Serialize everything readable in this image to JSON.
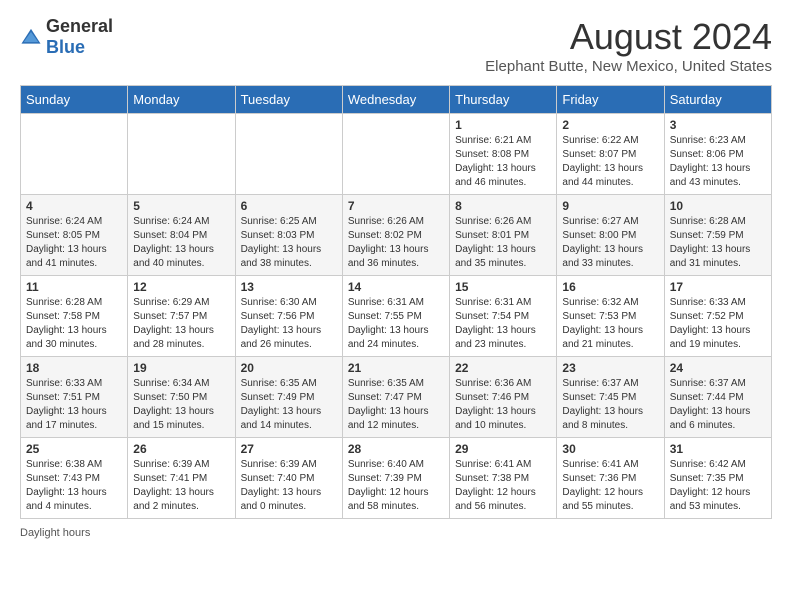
{
  "logo": {
    "general": "General",
    "blue": "Blue"
  },
  "header": {
    "month": "August 2024",
    "location": "Elephant Butte, New Mexico, United States"
  },
  "days_of_week": [
    "Sunday",
    "Monday",
    "Tuesday",
    "Wednesday",
    "Thursday",
    "Friday",
    "Saturday"
  ],
  "weeks": [
    [
      {
        "day": "",
        "sunrise": "",
        "sunset": "",
        "daylight": ""
      },
      {
        "day": "",
        "sunrise": "",
        "sunset": "",
        "daylight": ""
      },
      {
        "day": "",
        "sunrise": "",
        "sunset": "",
        "daylight": ""
      },
      {
        "day": "",
        "sunrise": "",
        "sunset": "",
        "daylight": ""
      },
      {
        "day": "1",
        "sunrise": "Sunrise: 6:21 AM",
        "sunset": "Sunset: 8:08 PM",
        "daylight": "Daylight: 13 hours and 46 minutes."
      },
      {
        "day": "2",
        "sunrise": "Sunrise: 6:22 AM",
        "sunset": "Sunset: 8:07 PM",
        "daylight": "Daylight: 13 hours and 44 minutes."
      },
      {
        "day": "3",
        "sunrise": "Sunrise: 6:23 AM",
        "sunset": "Sunset: 8:06 PM",
        "daylight": "Daylight: 13 hours and 43 minutes."
      }
    ],
    [
      {
        "day": "4",
        "sunrise": "Sunrise: 6:24 AM",
        "sunset": "Sunset: 8:05 PM",
        "daylight": "Daylight: 13 hours and 41 minutes."
      },
      {
        "day": "5",
        "sunrise": "Sunrise: 6:24 AM",
        "sunset": "Sunset: 8:04 PM",
        "daylight": "Daylight: 13 hours and 40 minutes."
      },
      {
        "day": "6",
        "sunrise": "Sunrise: 6:25 AM",
        "sunset": "Sunset: 8:03 PM",
        "daylight": "Daylight: 13 hours and 38 minutes."
      },
      {
        "day": "7",
        "sunrise": "Sunrise: 6:26 AM",
        "sunset": "Sunset: 8:02 PM",
        "daylight": "Daylight: 13 hours and 36 minutes."
      },
      {
        "day": "8",
        "sunrise": "Sunrise: 6:26 AM",
        "sunset": "Sunset: 8:01 PM",
        "daylight": "Daylight: 13 hours and 35 minutes."
      },
      {
        "day": "9",
        "sunrise": "Sunrise: 6:27 AM",
        "sunset": "Sunset: 8:00 PM",
        "daylight": "Daylight: 13 hours and 33 minutes."
      },
      {
        "day": "10",
        "sunrise": "Sunrise: 6:28 AM",
        "sunset": "Sunset: 7:59 PM",
        "daylight": "Daylight: 13 hours and 31 minutes."
      }
    ],
    [
      {
        "day": "11",
        "sunrise": "Sunrise: 6:28 AM",
        "sunset": "Sunset: 7:58 PM",
        "daylight": "Daylight: 13 hours and 30 minutes."
      },
      {
        "day": "12",
        "sunrise": "Sunrise: 6:29 AM",
        "sunset": "Sunset: 7:57 PM",
        "daylight": "Daylight: 13 hours and 28 minutes."
      },
      {
        "day": "13",
        "sunrise": "Sunrise: 6:30 AM",
        "sunset": "Sunset: 7:56 PM",
        "daylight": "Daylight: 13 hours and 26 minutes."
      },
      {
        "day": "14",
        "sunrise": "Sunrise: 6:31 AM",
        "sunset": "Sunset: 7:55 PM",
        "daylight": "Daylight: 13 hours and 24 minutes."
      },
      {
        "day": "15",
        "sunrise": "Sunrise: 6:31 AM",
        "sunset": "Sunset: 7:54 PM",
        "daylight": "Daylight: 13 hours and 23 minutes."
      },
      {
        "day": "16",
        "sunrise": "Sunrise: 6:32 AM",
        "sunset": "Sunset: 7:53 PM",
        "daylight": "Daylight: 13 hours and 21 minutes."
      },
      {
        "day": "17",
        "sunrise": "Sunrise: 6:33 AM",
        "sunset": "Sunset: 7:52 PM",
        "daylight": "Daylight: 13 hours and 19 minutes."
      }
    ],
    [
      {
        "day": "18",
        "sunrise": "Sunrise: 6:33 AM",
        "sunset": "Sunset: 7:51 PM",
        "daylight": "Daylight: 13 hours and 17 minutes."
      },
      {
        "day": "19",
        "sunrise": "Sunrise: 6:34 AM",
        "sunset": "Sunset: 7:50 PM",
        "daylight": "Daylight: 13 hours and 15 minutes."
      },
      {
        "day": "20",
        "sunrise": "Sunrise: 6:35 AM",
        "sunset": "Sunset: 7:49 PM",
        "daylight": "Daylight: 13 hours and 14 minutes."
      },
      {
        "day": "21",
        "sunrise": "Sunrise: 6:35 AM",
        "sunset": "Sunset: 7:47 PM",
        "daylight": "Daylight: 13 hours and 12 minutes."
      },
      {
        "day": "22",
        "sunrise": "Sunrise: 6:36 AM",
        "sunset": "Sunset: 7:46 PM",
        "daylight": "Daylight: 13 hours and 10 minutes."
      },
      {
        "day": "23",
        "sunrise": "Sunrise: 6:37 AM",
        "sunset": "Sunset: 7:45 PM",
        "daylight": "Daylight: 13 hours and 8 minutes."
      },
      {
        "day": "24",
        "sunrise": "Sunrise: 6:37 AM",
        "sunset": "Sunset: 7:44 PM",
        "daylight": "Daylight: 13 hours and 6 minutes."
      }
    ],
    [
      {
        "day": "25",
        "sunrise": "Sunrise: 6:38 AM",
        "sunset": "Sunset: 7:43 PM",
        "daylight": "Daylight: 13 hours and 4 minutes."
      },
      {
        "day": "26",
        "sunrise": "Sunrise: 6:39 AM",
        "sunset": "Sunset: 7:41 PM",
        "daylight": "Daylight: 13 hours and 2 minutes."
      },
      {
        "day": "27",
        "sunrise": "Sunrise: 6:39 AM",
        "sunset": "Sunset: 7:40 PM",
        "daylight": "Daylight: 13 hours and 0 minutes."
      },
      {
        "day": "28",
        "sunrise": "Sunrise: 6:40 AM",
        "sunset": "Sunset: 7:39 PM",
        "daylight": "Daylight: 12 hours and 58 minutes."
      },
      {
        "day": "29",
        "sunrise": "Sunrise: 6:41 AM",
        "sunset": "Sunset: 7:38 PM",
        "daylight": "Daylight: 12 hours and 56 minutes."
      },
      {
        "day": "30",
        "sunrise": "Sunrise: 6:41 AM",
        "sunset": "Sunset: 7:36 PM",
        "daylight": "Daylight: 12 hours and 55 minutes."
      },
      {
        "day": "31",
        "sunrise": "Sunrise: 6:42 AM",
        "sunset": "Sunset: 7:35 PM",
        "daylight": "Daylight: 12 hours and 53 minutes."
      }
    ]
  ],
  "footer": {
    "note": "Daylight hours"
  }
}
